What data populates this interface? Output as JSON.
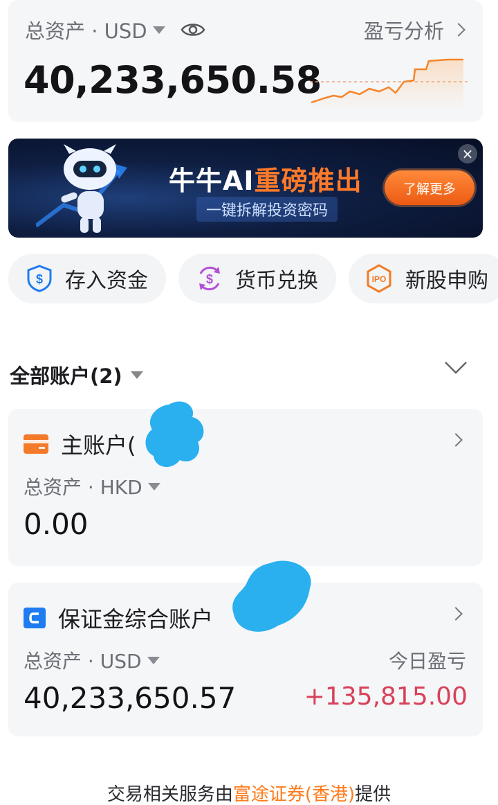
{
  "summary": {
    "label": "总资产 · USD",
    "total": "40,233,650.58",
    "pl_analysis": "盈亏分析"
  },
  "banner": {
    "title_main": "牛牛AI",
    "title_highlight": "重磅推出",
    "subtitle": "一键拆解投资密码",
    "cta": "了解更多",
    "close": "×"
  },
  "quick_actions": [
    {
      "label": "存入资金",
      "icon": "deposit-shield-icon"
    },
    {
      "label": "货币兑换",
      "icon": "currency-exchange-icon"
    },
    {
      "label": "新股申购",
      "icon": "ipo-icon"
    }
  ],
  "accounts_header": {
    "title": "全部账户(2)"
  },
  "accounts": [
    {
      "name": "主账户(",
      "icon": "card-icon",
      "icon_color": "#f47a2b",
      "asset_label": "总资产 · HKD",
      "asset_value": "0.00"
    },
    {
      "name": "保证金综合账户",
      "icon": "margin-account-icon",
      "icon_color": "#1f7cf0",
      "asset_label": "总资产 · USD",
      "asset_value": "40,233,650.57",
      "pl_label": "今日盈亏",
      "pl_value": "+135,815.00"
    }
  ],
  "footer": {
    "prefix": "交易相关服务由",
    "broker": "富途证券(香港)",
    "suffix": "提供"
  },
  "colors": {
    "accent_orange": "#ff7a1a",
    "profit_red": "#d8415a"
  }
}
